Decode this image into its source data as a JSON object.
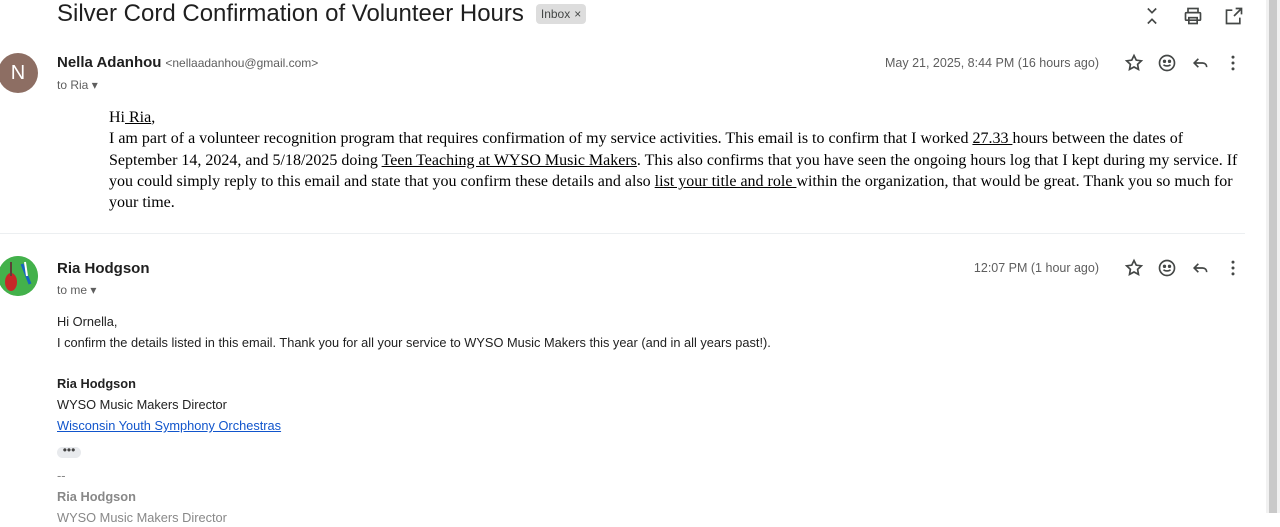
{
  "subject": "Silver Cord Confirmation of Volunteer Hours",
  "label": {
    "text": "Inbox",
    "close": "×"
  },
  "top_icons": [
    "expand-collapse-icon",
    "print-icon",
    "open-new-window-icon"
  ],
  "messages": [
    {
      "avatar_letter": "N",
      "avatar_color": "#8d6e63",
      "sender_name": "Nella Adanhou",
      "sender_email": "<nellaadanhou@gmail.com>",
      "to": "to Ria",
      "date": "May 21, 2025, 8:44 PM (16 hours ago)",
      "greeting_prefix": "Hi",
      "greeting_name": " Ria",
      "greeting_suffix": ",",
      "p1": "I am part of a volunteer recognition program that requires confirmation of my service activities. This email is to confirm that I worked ",
      "hours": "27.33 ",
      "p2": "hours between the dates of September 14, 2024, and  5/18/2025 doing ",
      "activity": "Teen Teaching at WYSO Music Makers",
      "p3": ". This also confirms that you have seen the ongoing hours log that I kept during my service. If you could simply reply to this email and state that you confirm these details and also ",
      "request": "list your title and role ",
      "p4": "within the organization, that would be great. Thank you so much for your time."
    },
    {
      "sender_name": "Ria Hodgson",
      "to": "to me",
      "date": "12:07 PM (1 hour ago)",
      "line1": "Hi Ornella,",
      "line2": "I confirm the details listed in this email. Thank you for all your service to WYSO Music Makers this year (and in all years past!).",
      "sig_name": "Ria Hodgson",
      "sig_title": "WYSO Music Makers Director",
      "sig_org": "Wisconsin Youth Symphony Orchestras",
      "more": "•••",
      "dashes": "--",
      "sig2_name": "Ria Hodgson",
      "sig2_title_partial": "WYSO Music Makers Director"
    }
  ]
}
